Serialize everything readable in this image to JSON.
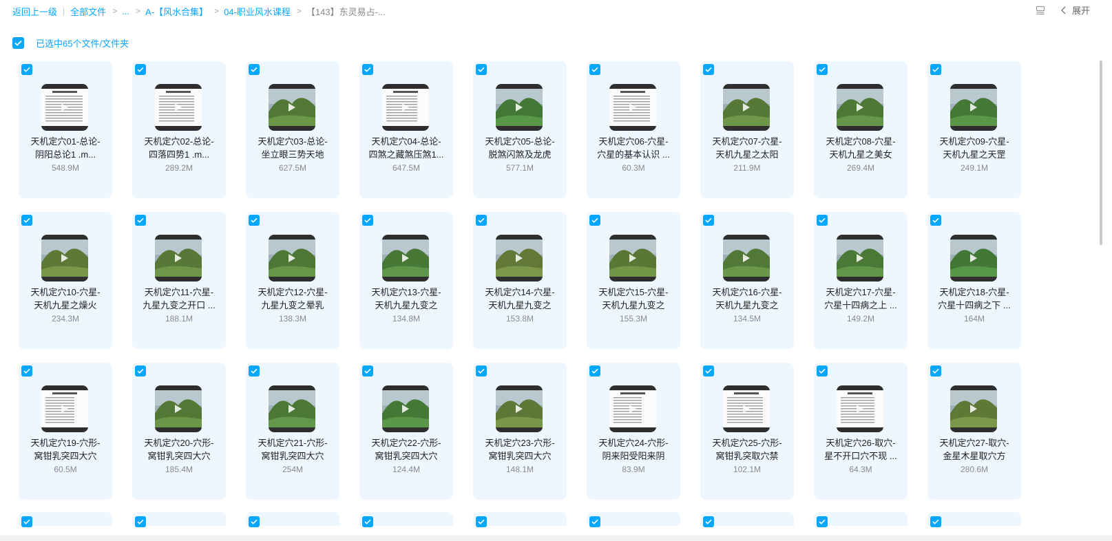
{
  "breadcrumb": {
    "back": "返回上一级",
    "root": "全部文件",
    "ellipsis": "...",
    "level1": "A-【风水合集】",
    "level2": "04-职业风水课程",
    "current": "【143】东灵易占-..."
  },
  "toolbar": {
    "expand_label": "展开"
  },
  "selection": {
    "label": "已选中65个文件/文件夹"
  },
  "colors": {
    "accent": "#06a7ff",
    "tile_bg": "#eef7ff"
  },
  "files": [
    {
      "line1": "天机定穴01-总论-",
      "line2": "阴阳总论1 .m...",
      "size": "548.9M",
      "thumb": "doc"
    },
    {
      "line1": "天机定穴02-总论-",
      "line2": "四落四势1 .m...",
      "size": "289.2M",
      "thumb": "doc"
    },
    {
      "line1": "天机定穴03-总论-",
      "line2": "坐立眼三势天地",
      "size": "627.5M",
      "thumb": "landscape"
    },
    {
      "line1": "天机定穴04-总论-",
      "line2": "四煞之藏煞压煞1...",
      "size": "647.5M",
      "thumb": "doc"
    },
    {
      "line1": "天机定穴05-总论-",
      "line2": "脱煞闪煞及龙虎",
      "size": "577.1M",
      "thumb": "landscape"
    },
    {
      "line1": "天机定穴06-穴星-",
      "line2": "穴星的基本认识 ...",
      "size": "60.3M",
      "thumb": "doc"
    },
    {
      "line1": "天机定穴07-穴星-",
      "line2": "天机九星之太阳",
      "size": "211.9M",
      "thumb": "landscape"
    },
    {
      "line1": "天机定穴08-穴星-",
      "line2": "天机九星之美女",
      "size": "269.4M",
      "thumb": "landscape"
    },
    {
      "line1": "天机定穴09-穴星-",
      "line2": "天机九星之天罡",
      "size": "249.1M",
      "thumb": "landscape"
    },
    {
      "line1": "天机定穴10-穴星-",
      "line2": "天机九星之燥火",
      "size": "234.3M",
      "thumb": "landscape"
    },
    {
      "line1": "天机定穴11-穴星-",
      "line2": "九星九变之开口 ...",
      "size": "188.1M",
      "thumb": "landscape"
    },
    {
      "line1": "天机定穴12-穴星-",
      "line2": "九星九变之晕乳",
      "size": "138.3M",
      "thumb": "landscape"
    },
    {
      "line1": "天机定穴13-穴星-",
      "line2": "天机九星九变之",
      "size": "134.8M",
      "thumb": "landscape"
    },
    {
      "line1": "天机定穴14-穴星-",
      "line2": "天机九星九变之",
      "size": "153.8M",
      "thumb": "landscape"
    },
    {
      "line1": "天机定穴15-穴星-",
      "line2": "天机九星九变之",
      "size": "155.3M",
      "thumb": "landscape"
    },
    {
      "line1": "天机定穴16-穴星-",
      "line2": "天机九星九变之",
      "size": "134.5M",
      "thumb": "landscape"
    },
    {
      "line1": "天机定穴17-穴星-",
      "line2": "穴星十四病之上 ...",
      "size": "149.2M",
      "thumb": "landscape"
    },
    {
      "line1": "天机定穴18-穴星-",
      "line2": "穴星十四病之下 ...",
      "size": "164M",
      "thumb": "landscape"
    },
    {
      "line1": "天机定穴19-穴形-",
      "line2": "窝钳乳突四大穴",
      "size": "60.5M",
      "thumb": "doc"
    },
    {
      "line1": "天机定穴20-穴形-",
      "line2": "窝钳乳突四大穴",
      "size": "185.4M",
      "thumb": "landscape"
    },
    {
      "line1": "天机定穴21-穴形-",
      "line2": "窝钳乳突四大穴",
      "size": "254M",
      "thumb": "landscape"
    },
    {
      "line1": "天机定穴22-穴形-",
      "line2": "窝钳乳突四大穴",
      "size": "124.4M",
      "thumb": "landscape"
    },
    {
      "line1": "天机定穴23-穴形-",
      "line2": "窝钳乳突四大穴",
      "size": "148.1M",
      "thumb": "landscape"
    },
    {
      "line1": "天机定穴24-穴形-",
      "line2": "阴来阳受阳来阴",
      "size": "83.9M",
      "thumb": "doc"
    },
    {
      "line1": "天机定穴25-穴形-",
      "line2": "窝钳乳突取穴禁",
      "size": "102.1M",
      "thumb": "doc"
    },
    {
      "line1": "天机定穴26-取穴-",
      "line2": "星不开口穴不现 ...",
      "size": "64.3M",
      "thumb": "doc"
    },
    {
      "line1": "天机定穴27-取穴-",
      "line2": "金星木星取穴方",
      "size": "280.6M",
      "thumb": "landscape"
    }
  ]
}
